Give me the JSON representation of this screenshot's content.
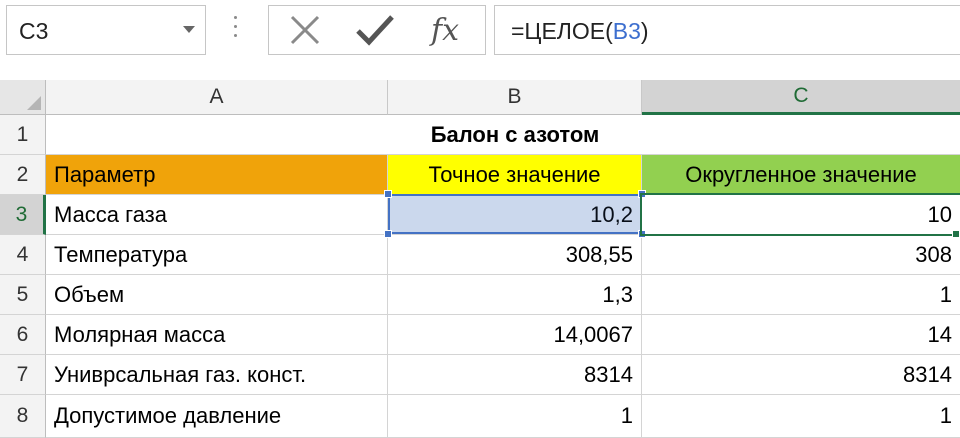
{
  "formula_bar": {
    "name_box": "C3",
    "formula_prefix": "=ЦЕЛОЕ(",
    "formula_ref": "B3",
    "formula_suffix": ")",
    "cancel_icon": "x-icon",
    "enter_icon": "check-icon",
    "function_label": "fx"
  },
  "columns": [
    "A",
    "B",
    "C"
  ],
  "rows": [
    "1",
    "2",
    "3",
    "4",
    "5",
    "6",
    "7",
    "8"
  ],
  "sheet": {
    "title": "Балон с азотом",
    "headers": [
      "Параметр",
      "Точное значение",
      "Округленное значение"
    ],
    "data": [
      [
        "Масса газа",
        "10,2",
        "10"
      ],
      [
        "Температура",
        "308,55",
        "308"
      ],
      [
        "Объем",
        "1,3",
        "1"
      ],
      [
        "Молярная масса",
        "14,0067",
        "14"
      ],
      [
        "Униврсальная газ. конст.",
        "8314",
        "8314"
      ],
      [
        "Допустимое давление",
        "1",
        "1"
      ]
    ]
  },
  "colors": {
    "header_a": "#f0a30a",
    "header_b": "#ffff00",
    "header_c": "#92d050",
    "selection": "#217346",
    "reference": "#4472c4"
  }
}
